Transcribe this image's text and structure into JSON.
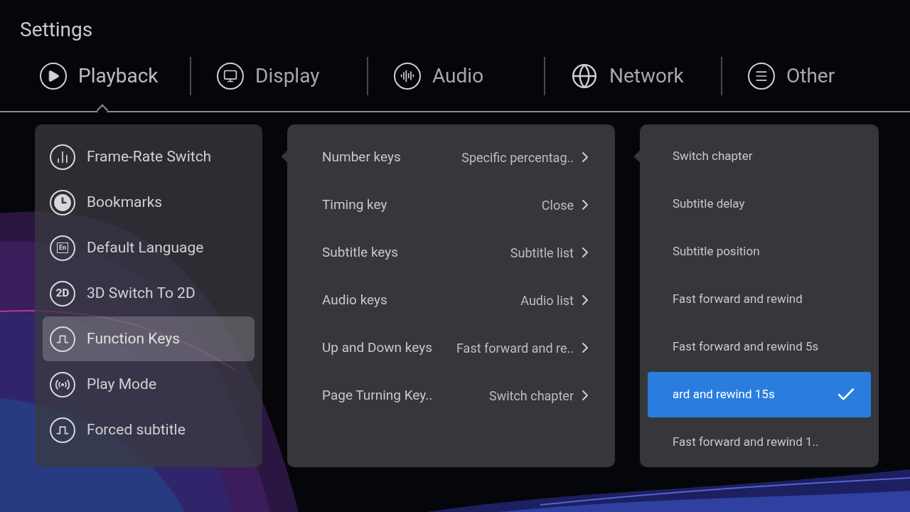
{
  "title": "Settings",
  "tabs": [
    {
      "label": "Playback",
      "kind": "play",
      "selected": true
    },
    {
      "label": "Display",
      "kind": "monitor",
      "selected": false
    },
    {
      "label": "Audio",
      "kind": "audio",
      "selected": false
    },
    {
      "label": "Network",
      "kind": "globe",
      "selected": false
    },
    {
      "label": "Other",
      "kind": "list",
      "selected": false
    }
  ],
  "categories": [
    {
      "label": "Frame-Rate Switch",
      "kind": "bars",
      "selected": false
    },
    {
      "label": "Bookmarks",
      "kind": "clock",
      "selected": false
    },
    {
      "label": "Default Language",
      "kind": "lang",
      "icon_text": "En",
      "selected": false
    },
    {
      "label": "3D Switch To 2D",
      "kind": "badge",
      "icon_text": "2D",
      "selected": false
    },
    {
      "label": "Function Keys",
      "kind": "pulse",
      "selected": true
    },
    {
      "label": "Play Mode",
      "kind": "broadcast",
      "selected": false
    },
    {
      "label": "Forced subtitle",
      "kind": "pulse",
      "selected": false
    }
  ],
  "keys": [
    {
      "label": "Number keys",
      "value": "Specific percentag.."
    },
    {
      "label": "Timing key",
      "value": "Close"
    },
    {
      "label": "Subtitle keys",
      "value": "Subtitle list"
    },
    {
      "label": "Audio keys",
      "value": "Audio list"
    },
    {
      "label": "Up and Down keys",
      "value": "Fast forward and re.."
    },
    {
      "label": "Page Turning Key..",
      "value": "Switch chapter"
    }
  ],
  "options": [
    {
      "label": "Switch chapter",
      "selected": false
    },
    {
      "label": "Subtitle delay",
      "selected": false
    },
    {
      "label": "Subtitle position",
      "selected": false
    },
    {
      "label": "Fast forward and rewind",
      "selected": false
    },
    {
      "label": "Fast forward and rewind 5s",
      "selected": false
    },
    {
      "label": "ard and rewind 15s",
      "selected": true
    },
    {
      "label": "Fast forward and rewind 1..",
      "selected": false
    }
  ]
}
